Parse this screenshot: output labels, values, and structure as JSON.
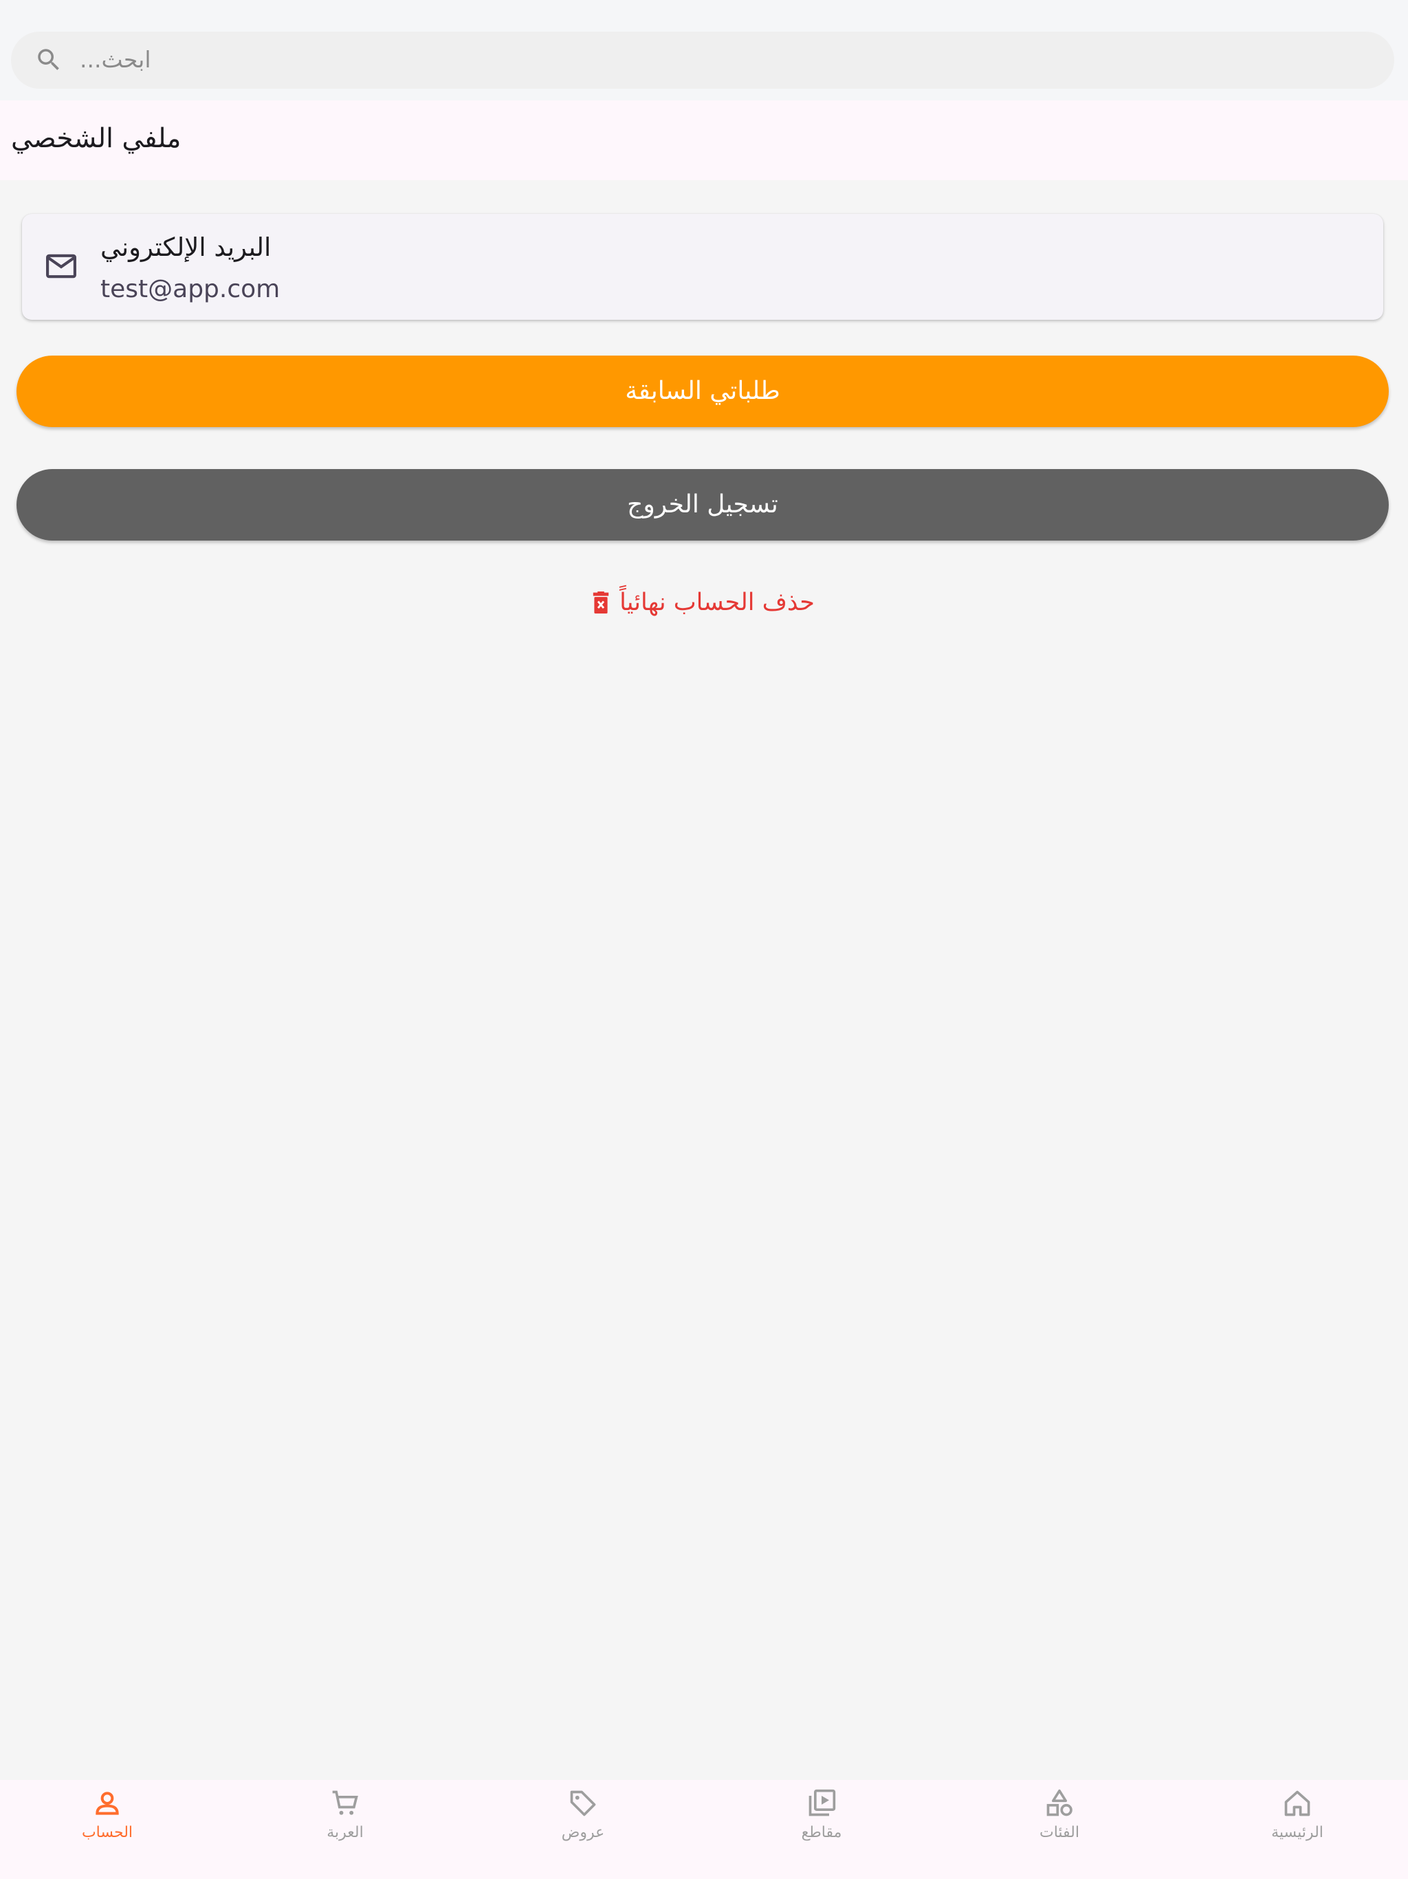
{
  "search": {
    "placeholder": "ابحث..."
  },
  "page": {
    "title": "ملفي الشخصي"
  },
  "profile": {
    "email_label": "البريد الإلكتروني",
    "email_value": "test@app.com"
  },
  "actions": {
    "orders_label": "طلباتي السابقة",
    "logout_label": "تسجيل الخروج",
    "delete_label": "حذف الحساب نهائياً"
  },
  "bottom_nav": {
    "items": [
      {
        "label": "الحساب",
        "icon": "account-icon",
        "active": true
      },
      {
        "label": "العربة",
        "icon": "cart-icon",
        "active": false
      },
      {
        "label": "عروض",
        "icon": "tag-icon",
        "active": false
      },
      {
        "label": "مقاطع",
        "icon": "video-library-icon",
        "active": false
      },
      {
        "label": "الفئات",
        "icon": "categories-icon",
        "active": false
      },
      {
        "label": "الرئيسية",
        "icon": "home-icon",
        "active": false
      }
    ]
  },
  "colors": {
    "primary_button": "#ff9800",
    "secondary_button": "#616161",
    "danger": "#e53935",
    "active_nav": "#ff6d2d",
    "inactive_nav": "#9e9e9e"
  }
}
